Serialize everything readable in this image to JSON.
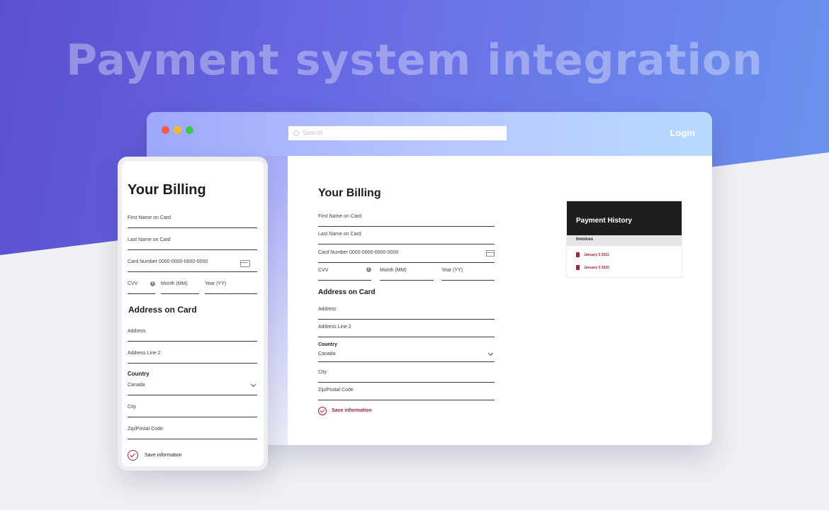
{
  "headline": "Payment system integration",
  "browser": {
    "search_placeholder": "Search",
    "login_label": "Login"
  },
  "billing": {
    "title": "Your Billing",
    "fields": {
      "first_name": "First Name on Card",
      "last_name": "Last Name on Card",
      "card_number": "Card Number 0000-0000-0000-0000",
      "cvv": "CVV",
      "month": "Month (MM)",
      "year": "Year (YY)"
    },
    "address_title": "Address on Card",
    "address": "Address",
    "address_line2": "Address Line 2",
    "country_label": "Country",
    "country_value": "Canada",
    "city": "City",
    "zip": "Zip/Postal Code",
    "save_label": "Save information"
  },
  "payment_history": {
    "title": "Payment History",
    "invoices_label": "Invoices",
    "invoices": [
      "January 5 2021",
      "January 5 2020"
    ]
  },
  "colors": {
    "accent": "#a4243b",
    "gradient_start": "#5b4fd0",
    "gradient_end": "#6b96ef"
  }
}
